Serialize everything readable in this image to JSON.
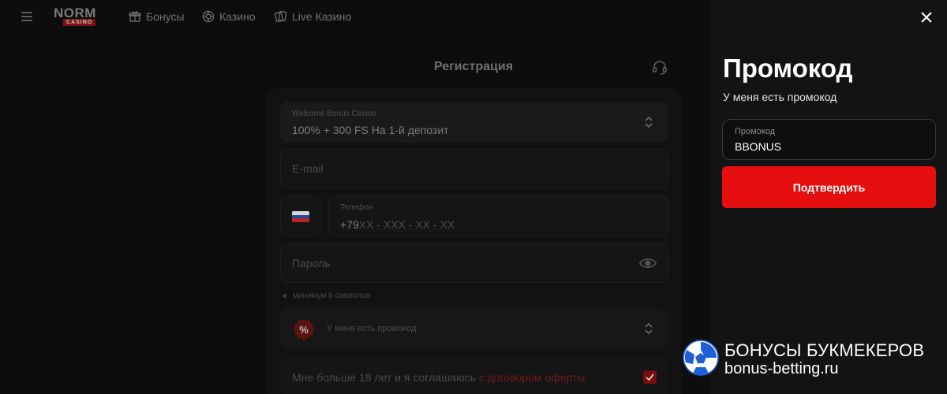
{
  "header": {
    "logo_main": "NORM",
    "logo_sub": "CASINO",
    "nav": [
      {
        "label": "Бонусы",
        "icon": "gift-icon"
      },
      {
        "label": "Казино",
        "icon": "casino-chip-icon"
      },
      {
        "label": "Live Казино",
        "icon": "cards-icon"
      }
    ]
  },
  "registration": {
    "title": "Регистрация",
    "bonus_select": {
      "label": "Welcome Bonus Casino",
      "value": "100% + 300 FS На 1-й депозит"
    },
    "email_placeholder": "E-mail",
    "phone": {
      "label": "Телефон",
      "prefix": "+79",
      "mask": "XX - XXX - XX - XX"
    },
    "password_placeholder": "Пароль",
    "password_hint": "минимум 8 символов",
    "promo_toggle_label": "У меня есть промокод",
    "agree_text": "Мне больше 18 лет и я соглашаюсь",
    "agree_link": "с договором оферты",
    "agree_checked": true
  },
  "promo_panel": {
    "title": "Промокод",
    "subtitle": "У меня есть промокод",
    "input_label": "Промокод",
    "input_value": "BBONUS",
    "confirm_label": "Подтвердить"
  },
  "watermark": {
    "line1": "БОНУСЫ БУКМЕКЕРОВ",
    "line2": "bonus-betting.ru"
  },
  "colors": {
    "accent_red": "#e60f0f",
    "panel_bg": "#131313",
    "page_bg": "#0d0d0d"
  }
}
